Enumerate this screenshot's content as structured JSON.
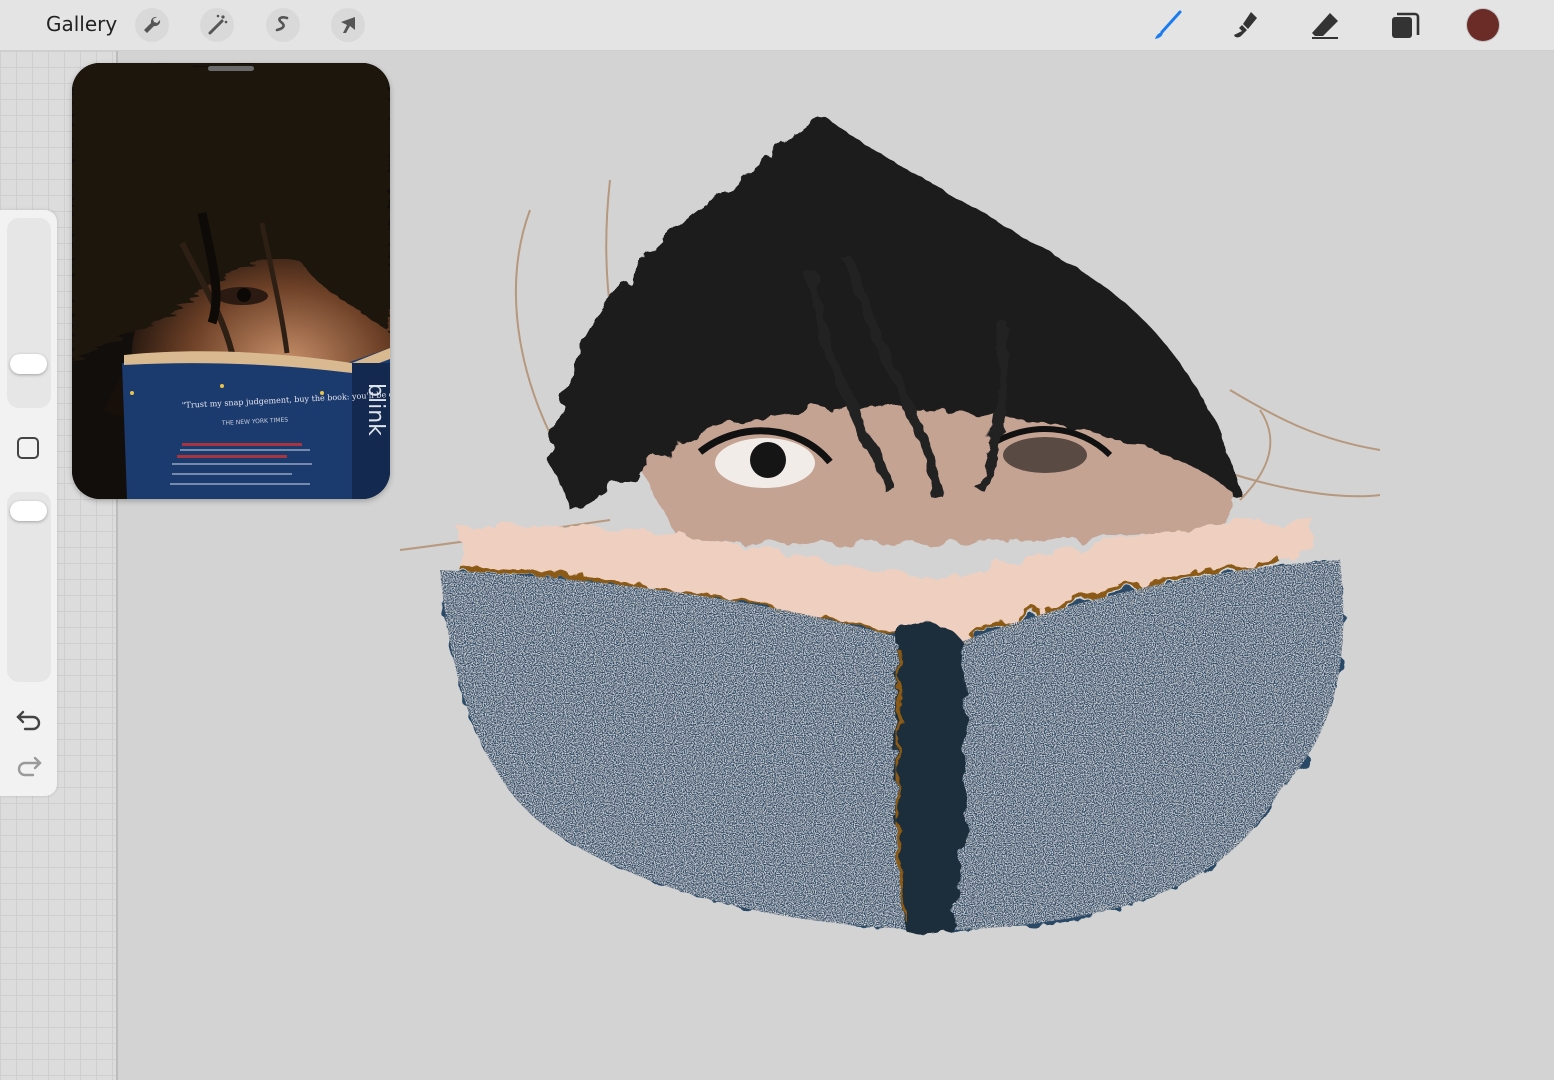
{
  "toolbar": {
    "gallery_label": "Gallery",
    "left_tools": [
      {
        "name": "actions",
        "icon": "wrench-icon"
      },
      {
        "name": "adjustments",
        "icon": "magic-wand-icon"
      },
      {
        "name": "selection",
        "icon": "selection-s-icon"
      },
      {
        "name": "transform",
        "icon": "arrow-cursor-icon"
      }
    ],
    "right_tools": [
      {
        "name": "brush",
        "icon": "brush-icon",
        "active": true
      },
      {
        "name": "smudge",
        "icon": "smudge-icon"
      },
      {
        "name": "eraser",
        "icon": "eraser-icon"
      },
      {
        "name": "layers",
        "icon": "layers-icon"
      }
    ],
    "active_color": "#6b2b26",
    "active_tool_color": "#1a7cf0"
  },
  "sidebar": {
    "brush_size_level": 0.2,
    "opacity_level": 0.95,
    "modify_icon": "square-icon",
    "undo_icon": "undo-icon",
    "redo_icon": "redo-icon"
  },
  "reference": {
    "book_cover_quote": "\"Trust my snap judgement, buy the book: you'll be delighted\"",
    "book_cover_source": "THE NEW YORK TIMES",
    "book_spine_title": "blink"
  },
  "colors": {
    "canvas_bg": "#d3d3d3",
    "book_blue": "#2b4a66",
    "hair": "#1c1c1c",
    "skin": "#c9a796",
    "pages": "#efd0c0"
  }
}
